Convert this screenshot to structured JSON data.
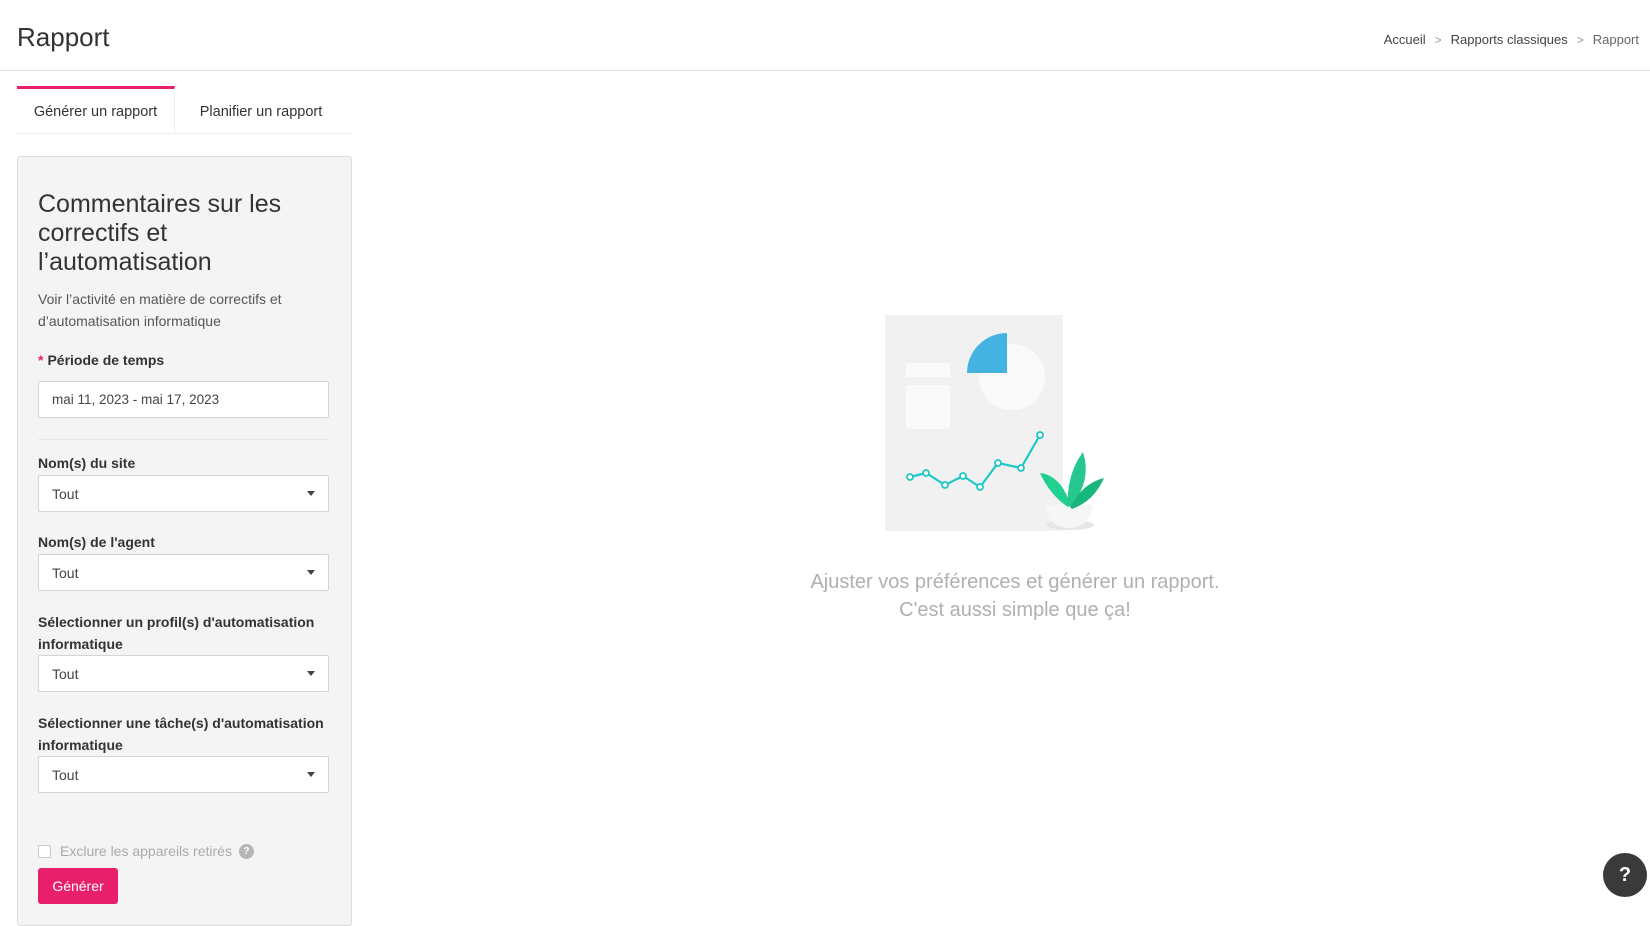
{
  "header": {
    "title": "Rapport",
    "breadcrumb": [
      {
        "label": "Accueil"
      },
      {
        "label": "Rapports classiques"
      },
      {
        "label": "Rapport"
      }
    ]
  },
  "tabs": [
    {
      "label": "Générer un rapport",
      "active": true
    },
    {
      "label": "Planifier un rapport",
      "active": false
    }
  ],
  "panel": {
    "title": "Commentaires sur les correctifs et l’automatisation",
    "description": "Voir l’activité en matière de correctifs et d’automatisation informatique",
    "period": {
      "label": "Période de temps",
      "required_mark": "*",
      "value": "mai 11, 2023 - mai 17, 2023"
    },
    "filters": [
      {
        "label": "Nom(s) du site",
        "value": "Tout"
      },
      {
        "label": "Nom(s) de l'agent",
        "value": "Tout"
      },
      {
        "label": "Sélectionner un profil(s) d'automatisation informatique",
        "value": "Tout"
      },
      {
        "label": "Sélectionner une tâche(s) d'automatisation informatique",
        "value": "Tout"
      }
    ],
    "exclude_checkbox": {
      "label": "Exclure les appareils retirés",
      "checked": false,
      "help_icon": "question-circle-icon"
    },
    "generate_label": "Générer"
  },
  "empty_state": {
    "line1": "Ajuster vos préférences et générer un rapport.",
    "line2": "C'est aussi simple que ça!"
  },
  "help_button": {
    "label": "?"
  },
  "colors": {
    "accent": "#e8206c",
    "chart_line": "#1fc8c8",
    "pie": "#44b3e1",
    "plant": "#26c88f",
    "muted_text": "#b0b0b0"
  }
}
